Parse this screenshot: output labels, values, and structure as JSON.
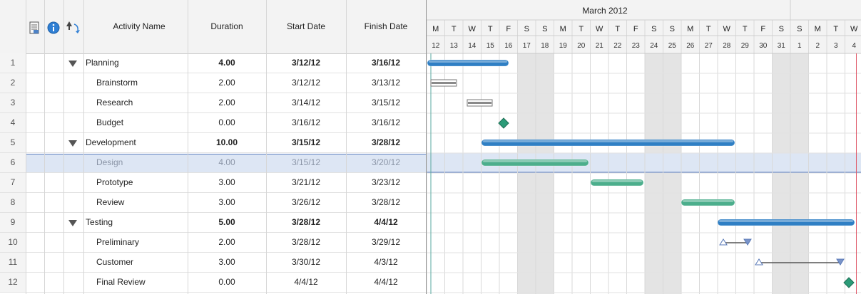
{
  "header": {
    "activity_name": "Activity Name",
    "duration": "Duration",
    "start_date": "Start Date",
    "finish_date": "Finish Date",
    "month": "March 2012",
    "weekdays": [
      "M",
      "T",
      "W",
      "T",
      "F",
      "S",
      "S",
      "M",
      "T",
      "W",
      "T",
      "F",
      "S",
      "S",
      "M",
      "T",
      "W",
      "T",
      "F",
      "S",
      "S",
      "M",
      "T",
      "W"
    ],
    "days": [
      "12",
      "13",
      "14",
      "15",
      "16",
      "17",
      "18",
      "19",
      "20",
      "21",
      "22",
      "23",
      "24",
      "25",
      "26",
      "27",
      "28",
      "29",
      "30",
      "31",
      "1",
      "2",
      "3",
      "4"
    ]
  },
  "icons": {
    "notes": "notes-icon",
    "info": "info-icon",
    "sort": "sort-icon"
  },
  "colors": {
    "summary_bar": "#2f7fc4",
    "task_bar": "#4cae8c",
    "critical_bar": "#8a8a8a",
    "milestone": "#2c9b78",
    "selection": "#dde6f4",
    "today_line": "#e05a6a",
    "weekend_shade": "#e4e4e4"
  },
  "rows": [
    {
      "num": "1",
      "name": "Planning",
      "duration": "4.00",
      "start": "3/12/12",
      "finish": "3/16/12",
      "summary": true
    },
    {
      "num": "2",
      "name": "Brainstorm",
      "duration": "2.00",
      "start": "3/12/12",
      "finish": "3/13/12",
      "summary": false
    },
    {
      "num": "3",
      "name": "Research",
      "duration": "2.00",
      "start": "3/14/12",
      "finish": "3/15/12",
      "summary": false
    },
    {
      "num": "4",
      "name": "Budget",
      "duration": "0.00",
      "start": "3/16/12",
      "finish": "3/16/12",
      "summary": false
    },
    {
      "num": "5",
      "name": "Development",
      "duration": "10.00",
      "start": "3/15/12",
      "finish": "3/28/12",
      "summary": true
    },
    {
      "num": "6",
      "name": "Design",
      "duration": "4.00",
      "start": "3/15/12",
      "finish": "3/20/12",
      "summary": false,
      "selected": true
    },
    {
      "num": "7",
      "name": "Prototype",
      "duration": "3.00",
      "start": "3/21/12",
      "finish": "3/23/12",
      "summary": false
    },
    {
      "num": "8",
      "name": "Review",
      "duration": "3.00",
      "start": "3/26/12",
      "finish": "3/28/12",
      "summary": false
    },
    {
      "num": "9",
      "name": "Testing",
      "duration": "5.00",
      "start": "3/28/12",
      "finish": "4/4/12",
      "summary": true
    },
    {
      "num": "10",
      "name": "Preliminary",
      "duration": "2.00",
      "start": "3/28/12",
      "finish": "3/29/12",
      "summary": false
    },
    {
      "num": "11",
      "name": "Customer",
      "duration": "3.00",
      "start": "3/30/12",
      "finish": "4/3/12",
      "summary": false
    },
    {
      "num": "12",
      "name": "Final Review",
      "duration": "0.00",
      "start": "4/4/12",
      "finish": "4/4/12",
      "summary": false
    }
  ]
}
